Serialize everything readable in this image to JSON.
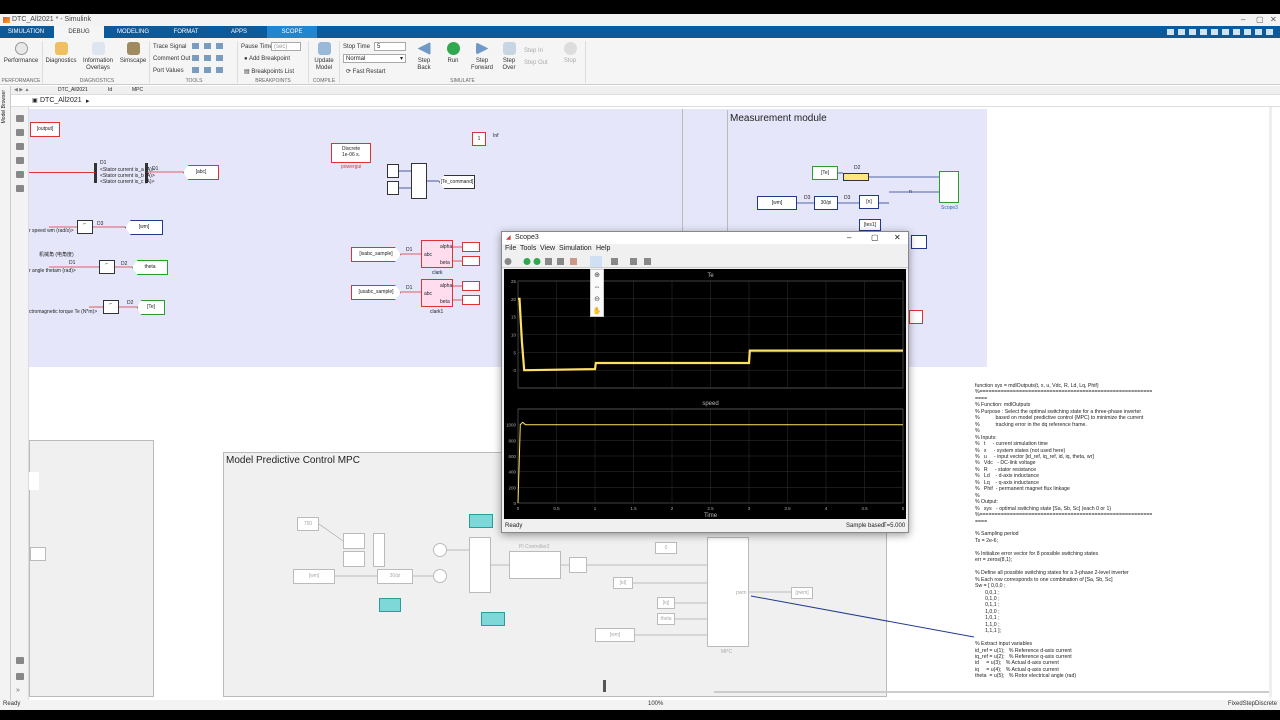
{
  "window": {
    "title": "DTC_All2021 * - Simulink"
  },
  "tabs": [
    {
      "label": "SIMULATION"
    },
    {
      "label": "DEBUG"
    },
    {
      "label": "MODELING"
    },
    {
      "label": "FORMAT"
    },
    {
      "label": "APPS"
    },
    {
      "label": "SCOPE"
    }
  ],
  "ribbon": {
    "performance": "Performance",
    "diagnostics": "Diagnostics",
    "information": "Information",
    "overlays": "Overlays",
    "simscape": "Simscape",
    "trace_signal": "Trace Signal",
    "comment_out": "Comment Out",
    "port_values": "Port Values",
    "pause_time": "Pause Time",
    "pause_time_placeholder": "(sec)",
    "add_breakpoint": "Add Breakpoint",
    "breakpoints_list": "Breakpoints List",
    "update_model_1": "Update",
    "update_model_2": "Model",
    "stop_time_label": "Stop Time",
    "stop_time": "5",
    "mode": "Normal",
    "fast_restart": "Fast Restart",
    "step_back_1": "Step",
    "step_back_2": "Back",
    "run": "Run",
    "step_forward_1": "Step",
    "step_forward_2": "Forward",
    "step_over_1": "Step",
    "step_over_2": "Over",
    "step_in": "Step In",
    "step_out": "Step Out",
    "stop": "Stop",
    "sections": {
      "performance": "PERFORMANCE",
      "diagnostics": "DIAGNOSTICS",
      "tools": "TOOLS",
      "breakpoints": "BREAKPOINTS",
      "compile": "COMPILE",
      "simulate": "SIMULATE"
    }
  },
  "nav": {
    "tabs": [
      "DTC_All2021",
      "Id",
      "MPC"
    ],
    "breadcrumb": "DTC_All2021",
    "model_browser": "Model Browser"
  },
  "diagram": {
    "measurement_title": "Measurement module",
    "mpc_title": "Model Predictive Control MPC",
    "output_tag": "[output]",
    "abc_tag": "[abc]",
    "wm_tag": "[wm]",
    "theta_tag": "theta",
    "te_tag": "[Te]",
    "discrete_1": "Discrete",
    "discrete_2": "1e-06 s.",
    "powergui": "powergui",
    "one_block": "1",
    "inf_label": "Inf",
    "te_command": "[Te_command]",
    "isabc_sample": "[isabc_sample]",
    "usabc_sample": "[usabc_sample]",
    "clark": "clark",
    "clark1": "clark1",
    "alpha": "alpha",
    "beta": "beta",
    "abc": "abc",
    "stator_a": "<Stator current is_a (A)>",
    "stator_b": "<Stator current is_b (A)>",
    "stator_c": "<Stator current is_c (A)>",
    "speed_label": "r speed wm (rad/s)>",
    "angle_cn": "机械角 (电角度)",
    "angle_label": "r angle thetam (rad)>",
    "torque_label": "ctromagnetic torque Te (N*m)>",
    "d1": "D1",
    "d2": "D2",
    "d3": "D3",
    "scope3": "Scope3",
    "pi_controller": "PI Controller2",
    "mpc_label": "MPC",
    "pwm_label": "pwm",
    "te_wm": "[Te]_wm",
    "k_750": "750",
    "wm_tag2": "[wm]",
    "id_tag": "[id]",
    "iq_tag": "[iq]",
    "theta2": "theta",
    "wm3": "[wm]",
    "pwm_out": "[pwm]",
    "te_command_short": "Te_command",
    "div30": "30/pi",
    "n_label": "n",
    "te2": "[Te]",
    "n2": "[n]",
    "tes1": "[tes1]",
    "wm4": "[wm]"
  },
  "scope": {
    "title": "Scope3",
    "menu": [
      "File",
      "Tools",
      "View",
      "Simulation",
      "Help"
    ],
    "plot1_title": "Te",
    "plot2_title": "speed",
    "xlabel": "Time",
    "status": "Ready",
    "sample_based": "Sample based",
    "time": "T=5.000"
  },
  "code": {
    "lines": [
      "function sys = mdlOutputs(t, x, u, Vdc, R, Ld, Lq, Phif)",
      "%=========================================================",
      "====",
      "% Function: mdlOutputs",
      "% Purpose : Select the optimal switching state for a three-phase inverter",
      "%           based on model predictive control (MPC) to minimize the current",
      "%           tracking error in the dq reference frame.",
      "%",
      "% Inputs:",
      "%   t     - current simulation time",
      "%   x     - system states (not used here)",
      "%   u     - input vector [id_ref, iq_ref, id, iq, theta, wr]",
      "%   Vdc   - DC-link voltage",
      "%   R     - stator resistance",
      "%   Ld    - d-axis inductance",
      "%   Lq    - q-axis inductance",
      "%   Phif  - permanent magnet flux linkage",
      "%",
      "% Output:",
      "%   sys   - optimal switching state [Sa, Sb, Sc] (each 0 or 1)",
      "%=========================================================",
      "====",
      "",
      "% Sampling period",
      "Ts = 2e-6;",
      "",
      "% Initialize error vector for 8 possible switching states",
      "err = zeros(8,1);",
      "",
      "% Define all possible switching states for a 3-phase 2-level inverter",
      "% Each row corresponds to one combination of [Sa, Sb, Sc]",
      "Sw = [ 0,0,0 ;",
      "       0,0,1 ;",
      "       0,1,0 ;",
      "       0,1,1 ;",
      "       1,0,0 ;",
      "       1,0,1 ;",
      "       1,1,0 ;",
      "       1,1,1 ];",
      "",
      "% Extract input variables",
      "id_ref = u(1);   % Reference d-axis current",
      "iq_ref = u(2);   % Reference q-axis current",
      "id     = u(3);   % Actual d-axis current",
      "iq     = u(4);   % Actual q-axis current",
      "theta  = u(5);   % Rotor electrical angle (rad)"
    ]
  },
  "statusbar": {
    "left": "Ready",
    "zoom": "100%",
    "solver": "FixedStepDiscrete"
  },
  "chart_data": [
    {
      "type": "line",
      "title": "Te",
      "xlim": [
        0,
        5
      ],
      "ylim": [
        -5,
        25
      ],
      "x_ticks": [
        "0",
        "0.5",
        "1",
        "1.5",
        "2",
        "2.5",
        "3",
        "3.5",
        "4",
        "4.5",
        "5"
      ],
      "y_ticks": [
        "0",
        "5",
        "10",
        "15",
        "20",
        "25"
      ],
      "series": [
        {
          "x": [
            0,
            0.02,
            0.05,
            0.08,
            0.1,
            0.99,
            1.0,
            1.01,
            2.99,
            3.0,
            3.01,
            5.0
          ],
          "y": [
            20,
            20,
            8,
            0,
            0,
            0.3,
            0.3,
            2,
            2,
            2,
            5.5,
            5.5
          ]
        }
      ],
      "color": "#ffe066",
      "grid": true
    },
    {
      "type": "line",
      "title": "speed",
      "xlabel": "Time",
      "xlim": [
        0,
        5
      ],
      "ylim": [
        0,
        1200
      ],
      "x_ticks": [
        "0",
        "0.5",
        "1",
        "1.5",
        "2",
        "2.5",
        "3",
        "3.5",
        "4",
        "4.5",
        "5"
      ],
      "y_ticks": [
        "0",
        "200",
        "400",
        "600",
        "800",
        "1000"
      ],
      "series": [
        {
          "x": [
            0,
            0.03,
            0.06,
            0.1,
            0.5,
            1,
            2,
            3,
            4,
            5
          ],
          "y": [
            0,
            1000,
            1030,
            1000,
            1000,
            1000,
            1000,
            1000,
            1000,
            1000
          ]
        }
      ],
      "color": "#ffe066",
      "grid": true
    }
  ]
}
